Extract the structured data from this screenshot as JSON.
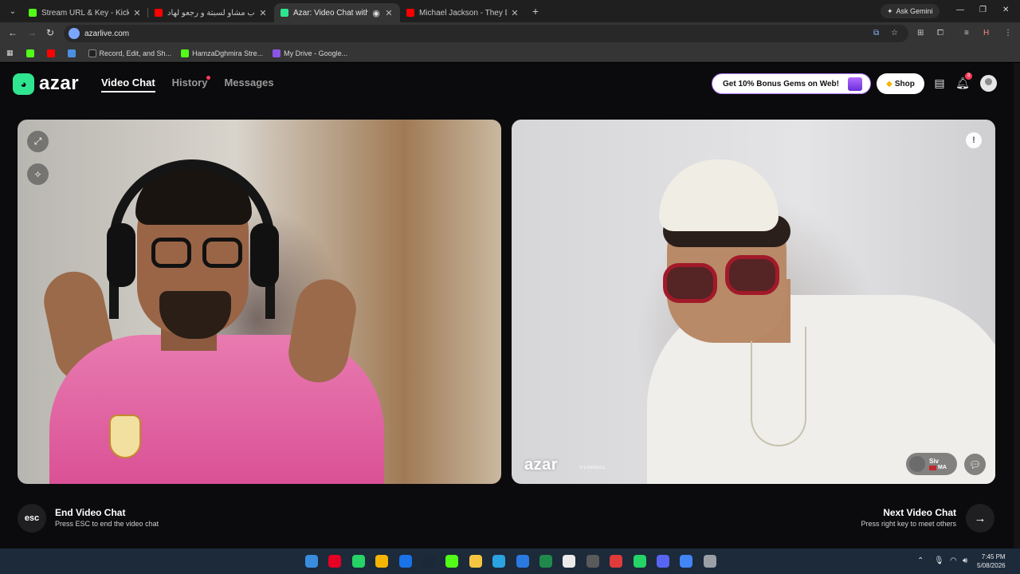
{
  "browser": {
    "tabs": [
      {
        "title": "Stream URL & Key - Kick Dashb",
        "fav_color": "#53fc18"
      },
      {
        "title": "الشباب مشاو لسبتة و رجعو لهاد",
        "fav_color": "#ff0000"
      },
      {
        "title": "Azar: Video Chat with New",
        "fav_color": "#2fe58f"
      },
      {
        "title": "Michael Jackson - They Don't C",
        "fav_color": "#ff0000"
      }
    ],
    "ask_gemini": "Ask Gemini",
    "url": "azarlive.com",
    "bookmarks": [
      {
        "label": "",
        "color": "#53fc18"
      },
      {
        "label": "",
        "color": "#ff0000"
      },
      {
        "label": "",
        "color": "#4a90e2"
      },
      {
        "label": "Record, Edit, and Sh...",
        "color": "#222222"
      },
      {
        "label": "HamzaDghmira Stre...",
        "color": "#53fc18"
      },
      {
        "label": "My Drive - Google...",
        "color": "#8a55e6"
      }
    ]
  },
  "app": {
    "logo": "azar",
    "nav": {
      "video_chat": "Video Chat",
      "history": "History",
      "messages": "Messages"
    },
    "bonus_label": "Get 10% Bonus Gems on Web!",
    "shop_label": "Shop",
    "notification_count": "3",
    "watermark": "azar",
    "watermark_id": "V-L0d095CL",
    "peer": {
      "name": "Siv",
      "country": "MA"
    },
    "end": {
      "key": "esc",
      "title": "End Video Chat",
      "subtitle": "Press ESC to end the video chat"
    },
    "next": {
      "title": "Next Video Chat",
      "subtitle": "Press right key to meet others"
    }
  },
  "taskbar": {
    "time": "7:45 PM",
    "date": "5/08/2026",
    "apps": [
      "#3a8dde",
      "#e60023",
      "#25d366",
      "#f4b400",
      "#1a73e8",
      "#1b2838",
      "#53fc18",
      "#f5c542",
      "#2aa3e0",
      "#2a7ae2",
      "#1f8a4c",
      "#eaeaea",
      "#5a5a5a",
      "#e03a3a",
      "#25d366",
      "#5865f2",
      "#4285f4",
      "#9aa0a6"
    ]
  },
  "colors": {
    "accent": "#2fe58f",
    "bonus_border": "#b57cff",
    "badge": "#ff3b5c"
  }
}
